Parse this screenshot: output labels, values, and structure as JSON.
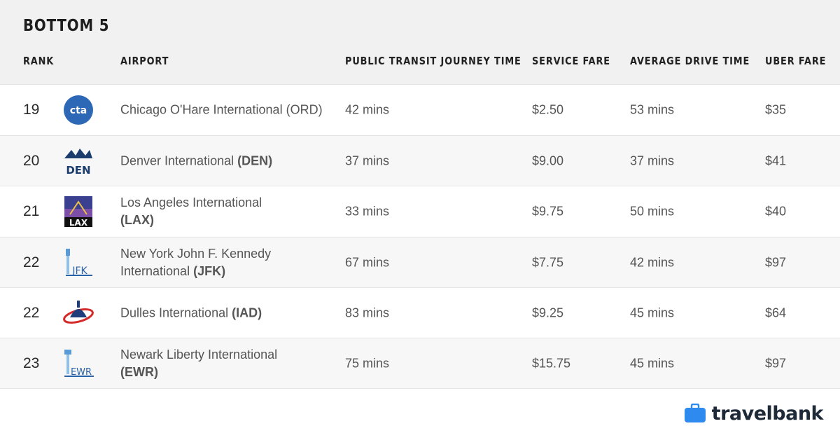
{
  "title": "BOTTOM 5",
  "columns": {
    "rank": "RANK",
    "airport": "AIRPORT",
    "transit": "PUBLIC TRANSIT JOURNEY TIME",
    "fare": "SERVICE FARE",
    "drive": "AVERAGE DRIVE TIME",
    "uber": "UBER FARE"
  },
  "rows": [
    {
      "rank": "19",
      "logo_icon": "cta-logo-icon",
      "airport_name": "Chicago O'Hare International",
      "airport_code": "(ORD)",
      "transit": "42 mins",
      "fare": "$2.50",
      "drive": "53 mins",
      "uber": "$35"
    },
    {
      "rank": "20",
      "logo_icon": "den-logo-icon",
      "airport_name": "Denver International",
      "airport_code": "(DEN)",
      "transit": "37 mins",
      "fare": "$9.00",
      "drive": "37 mins",
      "uber": "$41"
    },
    {
      "rank": "21",
      "logo_icon": "lax-logo-icon",
      "airport_name": "Los Angeles International",
      "airport_code": "(LAX)",
      "transit": "33 mins",
      "fare": "$9.75",
      "drive": "50 mins",
      "uber": "$40"
    },
    {
      "rank": "22",
      "logo_icon": "jfk-logo-icon",
      "airport_name": "New York John F. Kennedy International",
      "airport_code": "(JFK)",
      "transit": "67 mins",
      "fare": "$7.75",
      "drive": "42 mins",
      "uber": "$97"
    },
    {
      "rank": "22",
      "logo_icon": "iad-logo-icon",
      "airport_name": "Dulles International",
      "airport_code": "(IAD)",
      "transit": "83 mins",
      "fare": "$9.25",
      "drive": "45 mins",
      "uber": "$64"
    },
    {
      "rank": "23",
      "logo_icon": "ewr-logo-icon",
      "airport_name": "Newark Liberty International",
      "airport_code": "(EWR)",
      "transit": "75 mins",
      "fare": "$15.75",
      "drive": "45 mins",
      "uber": "$97"
    }
  ],
  "logo_text": {
    "cta": "cta",
    "den": "DEN",
    "lax": "LAX",
    "jfk": "JFK",
    "ewr": "EWR"
  },
  "brand": {
    "part1": "travel",
    "part2": "bank",
    "icon": "briefcase-icon",
    "accent": "#2f8af0"
  }
}
